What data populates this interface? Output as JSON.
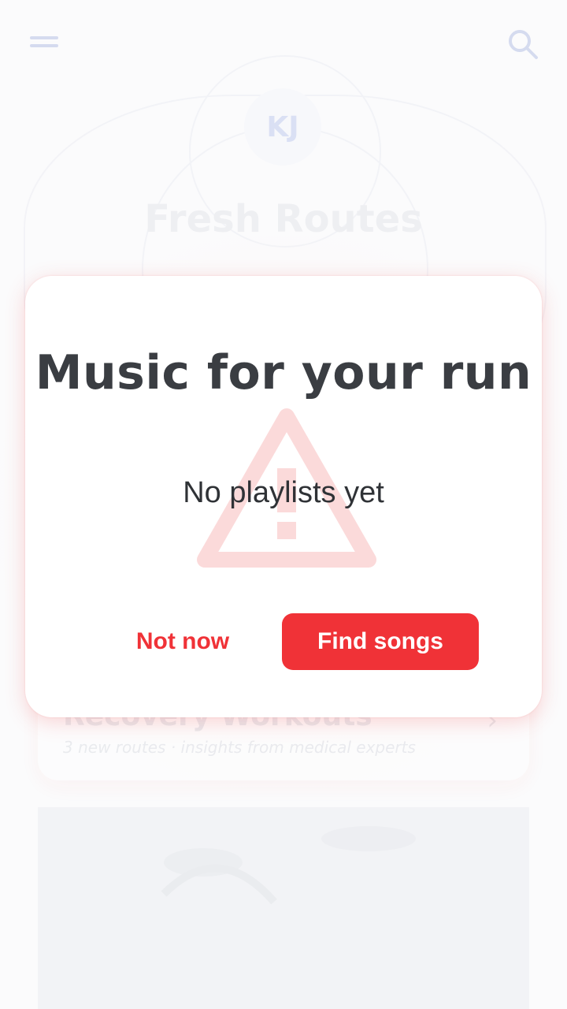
{
  "background": {
    "avatar_initials": "KJ",
    "title": "Fresh Routes",
    "card": {
      "title": "Recovery Workouts",
      "subtitle": "3 new routes · insights from medical experts"
    },
    "icons": {
      "menu": "menu-icon",
      "search": "search-icon",
      "chevron": "chevron-right-icon"
    }
  },
  "dialog": {
    "title": "Music for your run",
    "message": "No playlists yet",
    "secondary_button": "Not now",
    "primary_button": "Find songs",
    "watermark_icon": "warning-icon"
  },
  "colors": {
    "accent": "#f03237",
    "title_text": "#3a3d42",
    "body_text": "#2f3236",
    "menu_icon": "#8fa0d8"
  }
}
